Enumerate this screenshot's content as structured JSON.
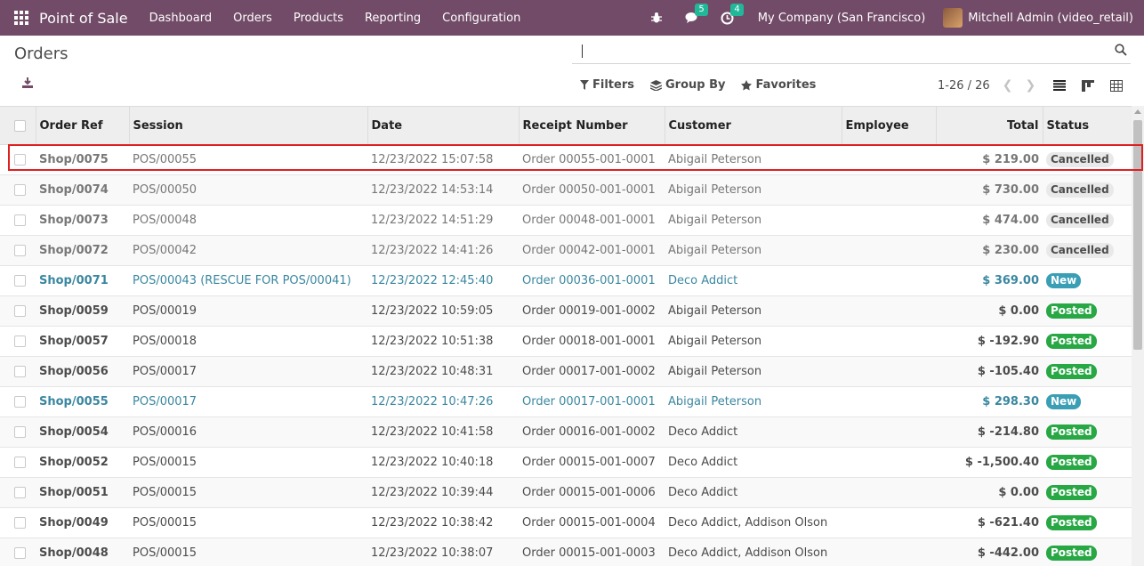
{
  "navbar": {
    "app_name": "Point of Sale",
    "menu": [
      "Dashboard",
      "Orders",
      "Products",
      "Reporting",
      "Configuration"
    ],
    "messages_count": "5",
    "activities_count": "4",
    "company": "My Company (San Francisco)",
    "user": "Mitchell Admin (video_retail)",
    "brand_color": "#714b67"
  },
  "control": {
    "title": "Orders",
    "search_value": "",
    "filters_label": "Filters",
    "groupby_label": "Group By",
    "favorites_label": "Favorites",
    "pager": "1-26 / 26"
  },
  "table": {
    "columns": [
      "Order Ref",
      "Session",
      "Date",
      "Receipt Number",
      "Customer",
      "Employee",
      "Total",
      "Status"
    ],
    "rows": [
      {
        "ref": "Shop/0075",
        "session": "POS/00055",
        "date": "12/23/2022 15:07:58",
        "receipt": "Order 00055-001-0001",
        "customer": "Abigail Peterson",
        "employee": "",
        "total": "$ 219.00",
        "status": "Cancelled",
        "state": "cancelled"
      },
      {
        "ref": "Shop/0074",
        "session": "POS/00050",
        "date": "12/23/2022 14:53:14",
        "receipt": "Order 00050-001-0001",
        "customer": "Abigail Peterson",
        "employee": "",
        "total": "$ 730.00",
        "status": "Cancelled",
        "state": "cancelled"
      },
      {
        "ref": "Shop/0073",
        "session": "POS/00048",
        "date": "12/23/2022 14:51:29",
        "receipt": "Order 00048-001-0001",
        "customer": "Abigail Peterson",
        "employee": "",
        "total": "$ 474.00",
        "status": "Cancelled",
        "state": "cancelled"
      },
      {
        "ref": "Shop/0072",
        "session": "POS/00042",
        "date": "12/23/2022 14:41:26",
        "receipt": "Order 00042-001-0001",
        "customer": "Abigail Peterson",
        "employee": "",
        "total": "$ 230.00",
        "status": "Cancelled",
        "state": "cancelled"
      },
      {
        "ref": "Shop/0071",
        "session": "POS/00043 (RESCUE FOR POS/00041)",
        "date": "12/23/2022 12:45:40",
        "receipt": "Order 00036-001-0001",
        "customer": "Deco Addict",
        "employee": "",
        "total": "$ 369.00",
        "status": "New",
        "state": "new"
      },
      {
        "ref": "Shop/0059",
        "session": "POS/00019",
        "date": "12/23/2022 10:59:05",
        "receipt": "Order 00019-001-0002",
        "customer": "Abigail Peterson",
        "employee": "",
        "total": "$ 0.00",
        "status": "Posted",
        "state": "posted"
      },
      {
        "ref": "Shop/0057",
        "session": "POS/00018",
        "date": "12/23/2022 10:51:38",
        "receipt": "Order 00018-001-0001",
        "customer": "Abigail Peterson",
        "employee": "",
        "total": "$ -192.90",
        "status": "Posted",
        "state": "posted"
      },
      {
        "ref": "Shop/0056",
        "session": "POS/00017",
        "date": "12/23/2022 10:48:31",
        "receipt": "Order 00017-001-0002",
        "customer": "Abigail Peterson",
        "employee": "",
        "total": "$ -105.40",
        "status": "Posted",
        "state": "posted"
      },
      {
        "ref": "Shop/0055",
        "session": "POS/00017",
        "date": "12/23/2022 10:47:26",
        "receipt": "Order 00017-001-0001",
        "customer": "Abigail Peterson",
        "employee": "",
        "total": "$ 298.30",
        "status": "New",
        "state": "new"
      },
      {
        "ref": "Shop/0054",
        "session": "POS/00016",
        "date": "12/23/2022 10:41:58",
        "receipt": "Order 00016-001-0002",
        "customer": "Deco Addict",
        "employee": "",
        "total": "$ -214.80",
        "status": "Posted",
        "state": "posted"
      },
      {
        "ref": "Shop/0052",
        "session": "POS/00015",
        "date": "12/23/2022 10:40:18",
        "receipt": "Order 00015-001-0007",
        "customer": "Deco Addict",
        "employee": "",
        "total": "$ -1,500.40",
        "status": "Posted",
        "state": "posted"
      },
      {
        "ref": "Shop/0051",
        "session": "POS/00015",
        "date": "12/23/2022 10:39:44",
        "receipt": "Order 00015-001-0006",
        "customer": "Deco Addict",
        "employee": "",
        "total": "$ 0.00",
        "status": "Posted",
        "state": "posted"
      },
      {
        "ref": "Shop/0049",
        "session": "POS/00015",
        "date": "12/23/2022 10:38:42",
        "receipt": "Order 00015-001-0004",
        "customer": "Deco Addict, Addison Olson",
        "employee": "",
        "total": "$ -621.40",
        "status": "Posted",
        "state": "posted"
      },
      {
        "ref": "Shop/0048",
        "session": "POS/00015",
        "date": "12/23/2022 10:38:07",
        "receipt": "Order 00015-001-0003",
        "customer": "Deco Addict, Addison Olson",
        "employee": "",
        "total": "$ -442.00",
        "status": "Posted",
        "state": "posted"
      }
    ]
  }
}
